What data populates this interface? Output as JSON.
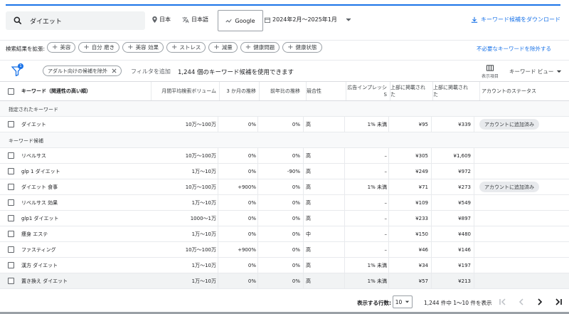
{
  "search": {
    "value": "ダイエット"
  },
  "filters": {
    "location": "日本",
    "language": "日本語",
    "engine": "Google",
    "date_range": "2024年2月～2025年1月"
  },
  "download_label": "キーワード候補をダウンロード",
  "expand": {
    "label": "検索結果を拡張:",
    "chips": [
      "美容",
      "自分 磨き",
      "美容 効果",
      "ストレス",
      "減量",
      "健康問題",
      "健康状態"
    ],
    "exclude_label": "不必要なキーワードを除外する"
  },
  "filterbar": {
    "badge": "1",
    "adult_chip": "アダルト向けの候補を除外",
    "add_filter": "フィルタを追加",
    "count_text": "1,244 個のキーワード候補を使用できます",
    "columns_label": "表示項目",
    "view_label": "キーワード ビュー"
  },
  "table": {
    "headers": {
      "keyword": "キーワード（関連性の高い順）",
      "volume": "月間平均検索ボリューム",
      "three_month": "3 か月の推移",
      "yoy": "前年比の推移",
      "competition": "競合性",
      "impression": "広告インプレッシ\nS",
      "low_bid": "上部に掲載された",
      "high_bid": "上部に掲載された",
      "status": "アカウントのステータス"
    },
    "section_specified": "指定されたキーワード",
    "specified_rows": [
      {
        "kw": "ダイエット",
        "vol": "10万～100万",
        "m3": "0%",
        "yoy": "0%",
        "comp": "高",
        "imp": "1% 未満",
        "low": "¥95",
        "high": "¥339",
        "status": "アカウントに追加済み"
      }
    ],
    "section_candidates": "キーワード候補",
    "rows": [
      {
        "kw": "リベルサス",
        "vol": "10万～100万",
        "m3": "0%",
        "yoy": "0%",
        "comp": "高",
        "imp": "–",
        "low": "¥305",
        "high": "¥1,609",
        "status": ""
      },
      {
        "kw": "glp 1 ダイエット",
        "vol": "1万～10万",
        "m3": "0%",
        "yoy": "-90%",
        "comp": "高",
        "imp": "–",
        "low": "¥249",
        "high": "¥972",
        "status": ""
      },
      {
        "kw": "ダイエット 食事",
        "vol": "10万～100万",
        "m3": "+900%",
        "yoy": "0%",
        "comp": "高",
        "imp": "1% 未満",
        "low": "¥71",
        "high": "¥273",
        "status": "アカウントに追加済み"
      },
      {
        "kw": "リベルサス 効果",
        "vol": "1万～10万",
        "m3": "0%",
        "yoy": "0%",
        "comp": "高",
        "imp": "–",
        "low": "¥109",
        "high": "¥549",
        "status": ""
      },
      {
        "kw": "glp1 ダイエット",
        "vol": "1000～1万",
        "m3": "0%",
        "yoy": "0%",
        "comp": "高",
        "imp": "–",
        "low": "¥233",
        "high": "¥897",
        "status": ""
      },
      {
        "kw": "痩身 エステ",
        "vol": "1万～10万",
        "m3": "0%",
        "yoy": "0%",
        "comp": "中",
        "imp": "–",
        "low": "¥150",
        "high": "¥480",
        "status": ""
      },
      {
        "kw": "ファスティング",
        "vol": "10万～100万",
        "m3": "+900%",
        "yoy": "0%",
        "comp": "高",
        "imp": "–",
        "low": "¥46",
        "high": "¥146",
        "status": ""
      },
      {
        "kw": "漢方 ダイエット",
        "vol": "1万～10万",
        "m3": "0%",
        "yoy": "0%",
        "comp": "高",
        "imp": "1% 未満",
        "low": "¥34",
        "high": "¥197",
        "status": ""
      },
      {
        "kw": "置き換え ダイエット",
        "vol": "1万～10万",
        "m3": "0%",
        "yoy": "0%",
        "comp": "高",
        "imp": "1% 未満",
        "low": "¥57",
        "high": "¥213",
        "status": ""
      }
    ]
  },
  "pager": {
    "rows_label": "表示する行数:",
    "rows_value": "10",
    "range": "1,244 件中 1～10 件を表示"
  },
  "colors": {
    "accent": "#1a73e8",
    "chip_bg": "#e8eaed"
  },
  "icons": [
    "search-icon",
    "pin-icon",
    "translate-icon",
    "chevron-down-icon",
    "download-icon",
    "plus-icon",
    "funnel-icon",
    "close-icon",
    "columns-icon",
    "first-page-icon",
    "prev-icon",
    "next-icon",
    "last-page-icon"
  ]
}
